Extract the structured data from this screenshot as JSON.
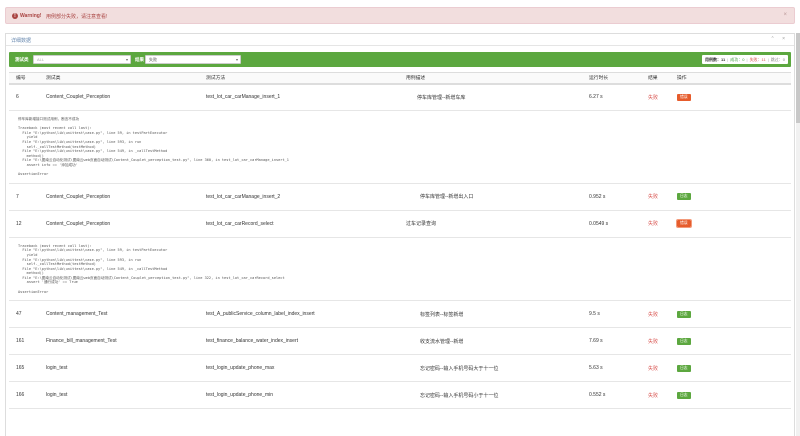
{
  "warning": {
    "title": "Warning!",
    "message": "用例部分失败，请注意查看!",
    "close": "×"
  },
  "panel": {
    "title": "详细数据",
    "controls": "⌃ ×"
  },
  "filter": {
    "test_label": "测试类",
    "test_placeholder": "ALL",
    "result_label": "结果",
    "result_value": "失败"
  },
  "stats": {
    "total": "用例数：11",
    "passed": "成功：0",
    "failed": "失败：11",
    "skipped": "跳过：0"
  },
  "columns": {
    "id": "编号",
    "class": "测试类",
    "method": "测试方法",
    "desc": "用例描述",
    "duration": "运行时长",
    "result": "结果",
    "action": "操作"
  },
  "rows": [
    {
      "id": "6",
      "class": "Content_Couplet_Perception",
      "method": "test_lot_car_carManage_insert_1",
      "desc": "停车库管理--新增车库",
      "duration": "6.27 s",
      "result": "失败",
      "action": "错误"
    },
    {
      "id": "7",
      "class": "Content_Couplet_Perception",
      "method": "test_lot_car_carManage_insert_2",
      "desc": "停车库管理--新增出入口",
      "duration": "0.952 s",
      "result": "失败",
      "action": "日志"
    },
    {
      "id": "12",
      "class": "Content_Couplet_Perception",
      "method": "test_lot_car_carRecord_select",
      "desc": "过车记录查询",
      "duration": "0.0549 s",
      "result": "失败",
      "action": "错误"
    },
    {
      "id": "47",
      "class": "Content_management_Test",
      "method": "test_A_publicService_column_label_index_insert",
      "desc": "标签列表--标签新增",
      "duration": "9.5 s",
      "result": "失败",
      "action": "日志"
    },
    {
      "id": "161",
      "class": "Finance_bill_management_Test",
      "method": "test_finance_balance_water_index_insert",
      "desc": "收支流水管理--新增",
      "duration": "7.69 s",
      "result": "失败",
      "action": "日志"
    },
    {
      "id": "165",
      "class": "login_test",
      "method": "test_login_update_phone_max",
      "desc": "忘记密码--输入手机号码大于十一位",
      "duration": "5.63 s",
      "result": "失败",
      "action": "日志"
    },
    {
      "id": "166",
      "class": "login_test",
      "method": "test_login_update_phone_min",
      "desc": "忘记密码--输入手机号码小于十一位",
      "duration": "0.552 s",
      "result": "失败",
      "action": "日志"
    }
  ],
  "traces": {
    "t1": "停车库新增接口测试用例，断言不成功\n\nTraceback (most recent call last):\n  File \"E:\\python\\lib\\unittest\\case.py\", line 59, in testPartExecutor\n    yield\n  File \"E:\\python\\lib\\unittest\\case.py\", line 593, in run\n    self._callTestMethod(testMethod)\n  File \"E:\\python\\lib\\unittest\\case.py\", line 549, in _callTestMethod\n    method()\n  File \"E:\\图南云自动化测试\\图南云web页面自动测试\\Content_Couplet_perception_test.py\", line 360, in test_lot_car_carManage_insert_1\n    assert info == '添加成功'\n\nAssertionError",
    "t2": "Traceback (most recent call last):\n  File \"E:\\python\\lib\\unittest\\case.py\", line 59, in testPartExecutor\n    yield\n  File \"E:\\python\\lib\\unittest\\case.py\", line 593, in run\n    self._callTestMethod(testMethod)\n  File \"E:\\python\\lib\\unittest\\case.py\", line 549, in _callTestMethod\n    method()\n  File \"E:\\图南云自动化测试\\图南云web页面自动测试\\Content_Couplet_perception_test.py\", line 322, in test_lot_car_carRecord_select\n    assert '通行成功' == True\n\nAssertionError"
  }
}
